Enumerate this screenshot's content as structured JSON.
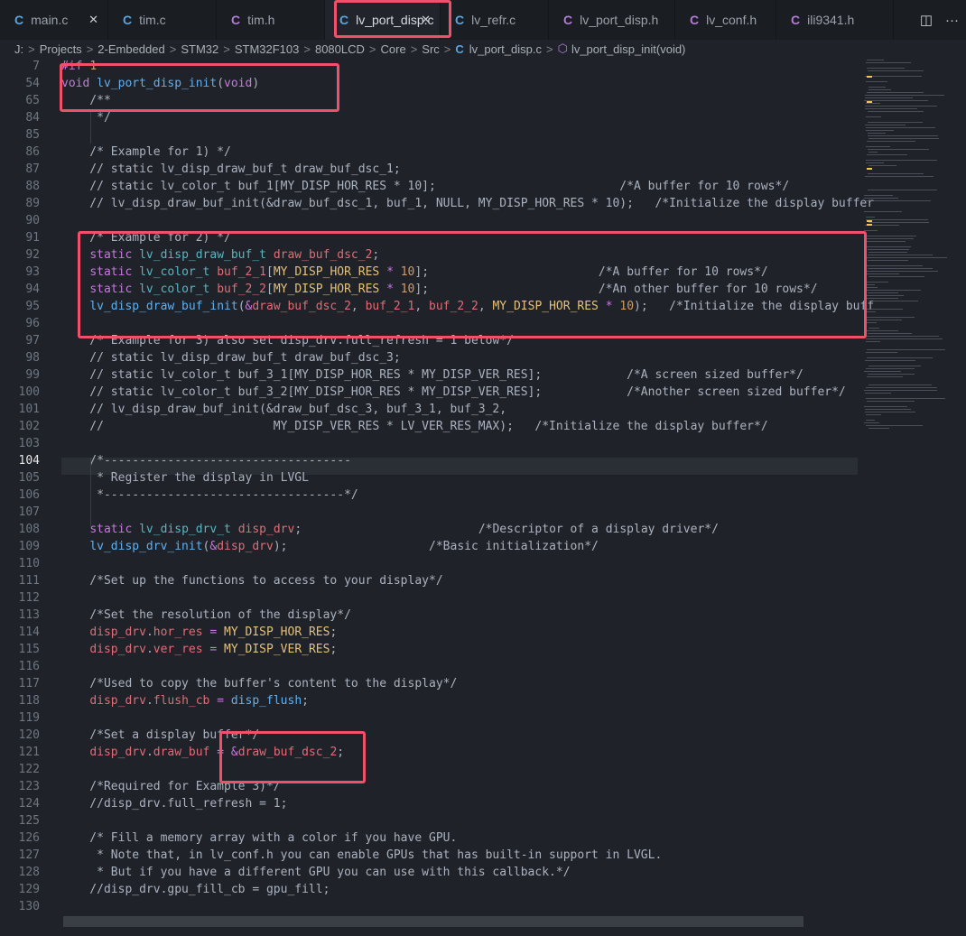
{
  "tabs": [
    {
      "label": "main.c",
      "kind": "c",
      "closable": true
    },
    {
      "label": "tim.c",
      "kind": "c"
    },
    {
      "label": "tim.h",
      "kind": "h"
    },
    {
      "label": "lv_port_disp.c",
      "kind": "c",
      "active": true,
      "closable": true
    },
    {
      "label": "lv_refr.c",
      "kind": "c"
    },
    {
      "label": "lv_port_disp.h",
      "kind": "h"
    },
    {
      "label": "lv_conf.h",
      "kind": "h"
    },
    {
      "label": "ili9341.h",
      "kind": "h"
    }
  ],
  "tab_icons": {
    "c": "C",
    "h": "C",
    "close": "✕"
  },
  "tab_actions": {
    "split": "◫",
    "more": "···"
  },
  "breadcrumb": {
    "drive": "J:",
    "parts": [
      "Projects",
      "2-Embedded",
      "STM32",
      "STM32F103",
      "8080LCD",
      "Core",
      "Src"
    ],
    "file": "lv_port_disp.c",
    "symbol": "lv_port_disp_init(void)",
    "sep": ">"
  },
  "current_line": "104",
  "lines": [
    {
      "n": "7",
      "code": "#if 1"
    },
    {
      "n": "54",
      "code": "void lv_port_disp_init(void)"
    },
    {
      "n": "65",
      "code": "    /**"
    },
    {
      "n": "84",
      "code": "     */"
    },
    {
      "n": "85",
      "code": ""
    },
    {
      "n": "86",
      "code": "    /* Example for 1) */"
    },
    {
      "n": "87",
      "code": "    // static lv_disp_draw_buf_t draw_buf_dsc_1;"
    },
    {
      "n": "88",
      "code": "    // static lv_color_t buf_1[MY_DISP_HOR_RES * 10];                          /*A buffer for 10 rows*/"
    },
    {
      "n": "89",
      "code": "    // lv_disp_draw_buf_init(&draw_buf_dsc_1, buf_1, NULL, MY_DISP_HOR_RES * 10);   /*Initialize the display buffer"
    },
    {
      "n": "90",
      "code": ""
    },
    {
      "n": "91",
      "code": "    /* Example for 2) */"
    },
    {
      "n": "92",
      "code": "    static lv_disp_draw_buf_t draw_buf_dsc_2;"
    },
    {
      "n": "93",
      "code": "    static lv_color_t buf_2_1[MY_DISP_HOR_RES * 10];                        /*A buffer for 10 rows*/"
    },
    {
      "n": "94",
      "code": "    static lv_color_t buf_2_2[MY_DISP_HOR_RES * 10];                        /*An other buffer for 10 rows*/"
    },
    {
      "n": "95",
      "code": "    lv_disp_draw_buf_init(&draw_buf_dsc_2, buf_2_1, buf_2_2, MY_DISP_HOR_RES * 10);   /*Initialize the display buff"
    },
    {
      "n": "96",
      "code": ""
    },
    {
      "n": "97",
      "code": "    /* Example for 3) also set disp_drv.full_refresh = 1 below*/"
    },
    {
      "n": "98",
      "code": "    // static lv_disp_draw_buf_t draw_buf_dsc_3;"
    },
    {
      "n": "99",
      "code": "    // static lv_color_t buf_3_1[MY_DISP_HOR_RES * MY_DISP_VER_RES];            /*A screen sized buffer*/"
    },
    {
      "n": "100",
      "code": "    // static lv_color_t buf_3_2[MY_DISP_HOR_RES * MY_DISP_VER_RES];            /*Another screen sized buffer*/"
    },
    {
      "n": "101",
      "code": "    // lv_disp_draw_buf_init(&draw_buf_dsc_3, buf_3_1, buf_3_2,"
    },
    {
      "n": "102",
      "code": "    //                        MY_DISP_VER_RES * LV_VER_RES_MAX);   /*Initialize the display buffer*/"
    },
    {
      "n": "103",
      "code": ""
    },
    {
      "n": "104",
      "code": "    /*-----------------------------------"
    },
    {
      "n": "105",
      "code": "     * Register the display in LVGL"
    },
    {
      "n": "106",
      "code": "     *----------------------------------*/"
    },
    {
      "n": "107",
      "code": ""
    },
    {
      "n": "108",
      "code": "    static lv_disp_drv_t disp_drv;                         /*Descriptor of a display driver*/"
    },
    {
      "n": "109",
      "code": "    lv_disp_drv_init(&disp_drv);                    /*Basic initialization*/"
    },
    {
      "n": "110",
      "code": ""
    },
    {
      "n": "111",
      "code": "    /*Set up the functions to access to your display*/"
    },
    {
      "n": "112",
      "code": ""
    },
    {
      "n": "113",
      "code": "    /*Set the resolution of the display*/"
    },
    {
      "n": "114",
      "code": "    disp_drv.hor_res = MY_DISP_HOR_RES;"
    },
    {
      "n": "115",
      "code": "    disp_drv.ver_res = MY_DISP_VER_RES;"
    },
    {
      "n": "116",
      "code": ""
    },
    {
      "n": "117",
      "code": "    /*Used to copy the buffer's content to the display*/"
    },
    {
      "n": "118",
      "code": "    disp_drv.flush_cb = disp_flush;"
    },
    {
      "n": "119",
      "code": ""
    },
    {
      "n": "120",
      "code": "    /*Set a display buffer*/"
    },
    {
      "n": "121",
      "code": "    disp_drv.draw_buf = &draw_buf_dsc_2;"
    },
    {
      "n": "122",
      "code": ""
    },
    {
      "n": "123",
      "code": "    /*Required for Example 3)*/"
    },
    {
      "n": "124",
      "code": "    //disp_drv.full_refresh = 1;"
    },
    {
      "n": "125",
      "code": ""
    },
    {
      "n": "126",
      "code": "    /* Fill a memory array with a color if you have GPU."
    },
    {
      "n": "127",
      "code": "     * Note that, in lv_conf.h you can enable GPUs that has built-in support in LVGL."
    },
    {
      "n": "128",
      "code": "     * But if you have a different GPU you can use with this callback.*/"
    },
    {
      "n": "129",
      "code": "    //disp_drv.gpu_fill_cb = gpu_fill;"
    },
    {
      "n": "130",
      "code": ""
    }
  ],
  "colors": {
    "highlight_box": "#f0506a",
    "background": "#1f2329",
    "accent": "#56a6e0"
  }
}
